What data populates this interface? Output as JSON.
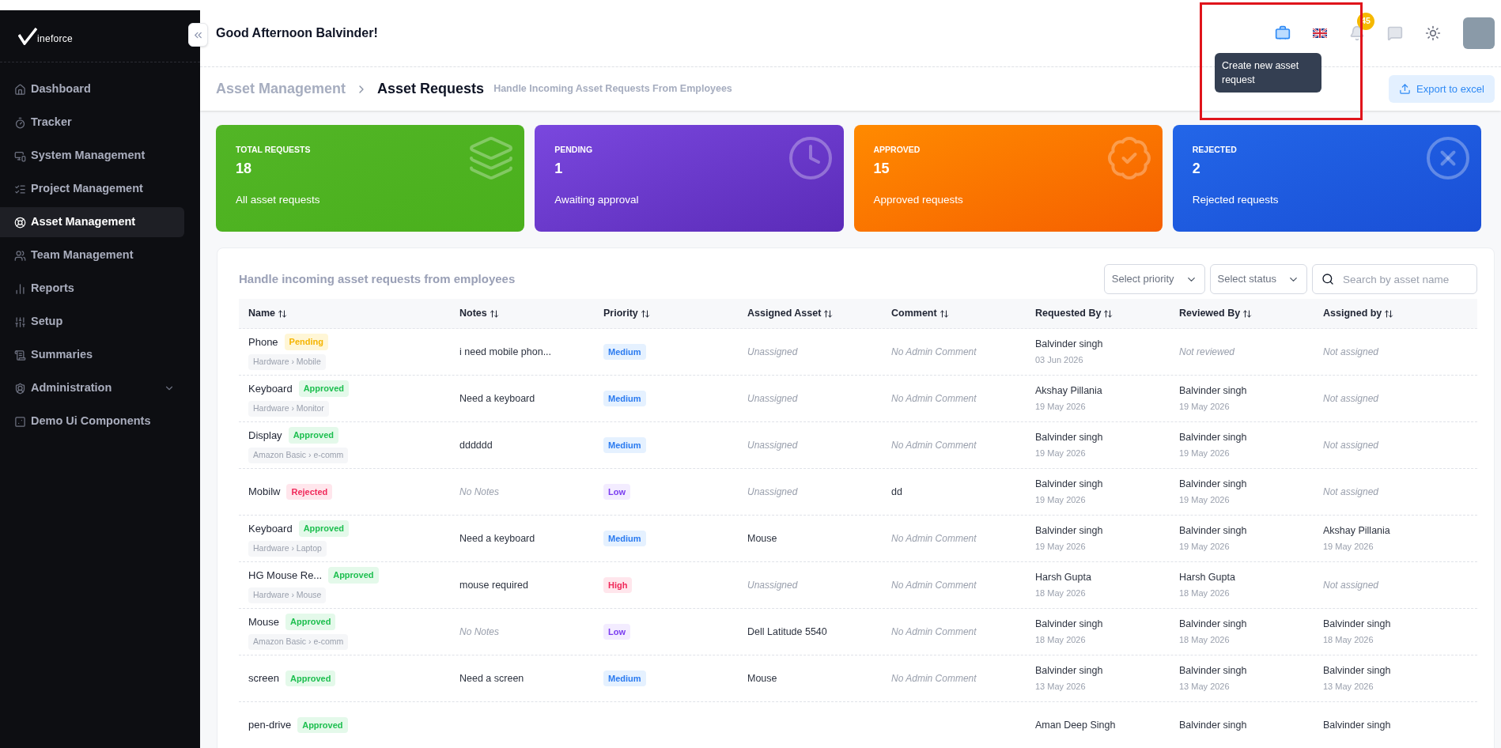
{
  "logo": {
    "text": "ineforce"
  },
  "sidebar": {
    "items": [
      {
        "label": "Dashboard",
        "selected": false
      },
      {
        "label": "Tracker",
        "selected": false
      },
      {
        "label": "System Management",
        "selected": false
      },
      {
        "label": "Project Management",
        "selected": false
      },
      {
        "label": "Asset Management",
        "selected": true
      },
      {
        "label": "Team Management",
        "selected": false
      },
      {
        "label": "Reports",
        "selected": false
      },
      {
        "label": "Setup",
        "selected": false
      },
      {
        "label": "Summaries",
        "selected": false
      },
      {
        "label": "Administration",
        "selected": false,
        "expandable": true
      },
      {
        "label": "Demo Ui Components",
        "selected": false
      }
    ]
  },
  "header": {
    "greeting": "Good Afternoon Balvinder!",
    "notification_count": "45",
    "tooltip": "Create new asset request"
  },
  "breadcrumb": {
    "parent": "Asset Management",
    "current": "Asset Requests",
    "subtitle": "Handle Incoming Asset Requests From Employees",
    "export_button": "Export to excel"
  },
  "stats": [
    {
      "kind": "total",
      "label": "TOTAL REQUESTS",
      "value": "18",
      "caption": "All asset requests"
    },
    {
      "kind": "pending",
      "label": "PENDING",
      "value": "1",
      "caption": "Awaiting approval"
    },
    {
      "kind": "approved",
      "label": "APPROVED",
      "value": "15",
      "caption": "Approved requests"
    },
    {
      "kind": "rejected",
      "label": "REJECTED",
      "value": "2",
      "caption": "Rejected requests"
    }
  ],
  "table": {
    "title": "Handle incoming asset requests from employees",
    "filters": [
      {
        "placeholder": "Select priority"
      },
      {
        "placeholder": "Select status"
      }
    ],
    "search": {
      "placeholder": "Search by asset name"
    },
    "columns": [
      "Name",
      "Notes",
      "Priority",
      "Assigned Asset",
      "Comment",
      "Requested By",
      "Reviewed By",
      "Assigned by"
    ],
    "rows": [
      {
        "name": "Phone",
        "status": {
          "kind": "pending",
          "text": "Pending"
        },
        "category": "Hardware › Mobile",
        "notes": {
          "text": "i need mobile phon...",
          "empty": false
        },
        "priority": {
          "kind": "medium",
          "text": "Medium"
        },
        "asset": {
          "text": "Unassigned",
          "empty": true
        },
        "comment": {
          "text": "No Admin Comment",
          "empty": true
        },
        "requested": {
          "text": "Balvinder singh",
          "date": "03 Jun 2026",
          "empty": false
        },
        "reviewed": {
          "text": "Not reviewed",
          "empty": true
        },
        "assigned_by": {
          "text": "Not assigned",
          "empty": true
        }
      },
      {
        "name": "Keyboard",
        "status": {
          "kind": "approved",
          "text": "Approved"
        },
        "category": "Hardware › Monitor",
        "notes": {
          "text": "Need a keyboard",
          "empty": false
        },
        "priority": {
          "kind": "medium",
          "text": "Medium"
        },
        "asset": {
          "text": "Unassigned",
          "empty": true
        },
        "comment": {
          "text": "No Admin Comment",
          "empty": true
        },
        "requested": {
          "text": "Akshay Pillania",
          "date": "19 May 2026",
          "empty": false
        },
        "reviewed": {
          "text": "Balvinder singh",
          "date": "19 May 2026",
          "empty": false
        },
        "assigned_by": {
          "text": "Not assigned",
          "empty": true
        }
      },
      {
        "name": "Display",
        "status": {
          "kind": "approved",
          "text": "Approved"
        },
        "category": "Amazon Basic › e-comm",
        "notes": {
          "text": "dddddd",
          "empty": false
        },
        "priority": {
          "kind": "medium",
          "text": "Medium"
        },
        "asset": {
          "text": "Unassigned",
          "empty": true
        },
        "comment": {
          "text": "No Admin Comment",
          "empty": true
        },
        "requested": {
          "text": "Balvinder singh",
          "date": "19 May 2026",
          "empty": false
        },
        "reviewed": {
          "text": "Balvinder singh",
          "date": "19 May 2026",
          "empty": false
        },
        "assigned_by": {
          "text": "Not assigned",
          "empty": true
        }
      },
      {
        "name": "Mobilw",
        "status": {
          "kind": "rejected",
          "text": "Rejected"
        },
        "notes": {
          "text": "No Notes",
          "empty": true
        },
        "priority": {
          "kind": "low",
          "text": "Low"
        },
        "asset": {
          "text": "Unassigned",
          "empty": true
        },
        "comment": {
          "text": "dd",
          "empty": false
        },
        "requested": {
          "text": "Balvinder singh",
          "date": "19 May 2026",
          "empty": false
        },
        "reviewed": {
          "text": "Balvinder singh",
          "date": "19 May 2026",
          "empty": false
        },
        "assigned_by": {
          "text": "Not assigned",
          "empty": true
        }
      },
      {
        "name": "Keyboard",
        "status": {
          "kind": "approved",
          "text": "Approved"
        },
        "category": "Hardware › Laptop",
        "notes": {
          "text": "Need a keyboard",
          "empty": false
        },
        "priority": {
          "kind": "medium",
          "text": "Medium"
        },
        "asset": {
          "text": "Mouse",
          "empty": false
        },
        "comment": {
          "text": "No Admin Comment",
          "empty": true
        },
        "requested": {
          "text": "Balvinder singh",
          "date": "19 May 2026",
          "empty": false
        },
        "reviewed": {
          "text": "Balvinder singh",
          "date": "19 May 2026",
          "empty": false
        },
        "assigned_by": {
          "text": "Akshay Pillania",
          "date": "19 May 2026",
          "empty": false
        }
      },
      {
        "name": "HG Mouse Re...",
        "status": {
          "kind": "approved",
          "text": "Approved"
        },
        "category": "Hardware › Mouse",
        "notes": {
          "text": "mouse required",
          "empty": false
        },
        "priority": {
          "kind": "high",
          "text": "High"
        },
        "asset": {
          "text": "Unassigned",
          "empty": true
        },
        "comment": {
          "text": "No Admin Comment",
          "empty": true
        },
        "requested": {
          "text": "Harsh Gupta",
          "date": "18 May 2026",
          "empty": false
        },
        "reviewed": {
          "text": "Harsh Gupta",
          "date": "18 May 2026",
          "empty": false
        },
        "assigned_by": {
          "text": "Not assigned",
          "empty": true
        }
      },
      {
        "name": "Mouse",
        "status": {
          "kind": "approved",
          "text": "Approved"
        },
        "category": "Amazon Basic › e-comm",
        "notes": {
          "text": "No Notes",
          "empty": true
        },
        "priority": {
          "kind": "low",
          "text": "Low"
        },
        "asset": {
          "text": "Dell Latitude 5540",
          "empty": false
        },
        "comment": {
          "text": "No Admin Comment",
          "empty": true
        },
        "requested": {
          "text": "Balvinder singh",
          "date": "18 May 2026",
          "empty": false
        },
        "reviewed": {
          "text": "Balvinder singh",
          "date": "18 May 2026",
          "empty": false
        },
        "assigned_by": {
          "text": "Balvinder singh",
          "date": "18 May 2026",
          "empty": false
        }
      },
      {
        "name": "screen",
        "status": {
          "kind": "approved",
          "text": "Approved"
        },
        "notes": {
          "text": "Need a screen",
          "empty": false
        },
        "priority": {
          "kind": "medium",
          "text": "Medium"
        },
        "asset": {
          "text": "Mouse",
          "empty": false
        },
        "comment": {
          "text": "No Admin Comment",
          "empty": true
        },
        "requested": {
          "text": "Balvinder singh",
          "date": "13 May 2026",
          "empty": false
        },
        "reviewed": {
          "text": "Balvinder singh",
          "date": "13 May 2026",
          "empty": false
        },
        "assigned_by": {
          "text": "Balvinder singh",
          "date": "13 May 2026",
          "empty": false
        }
      },
      {
        "name": "pen-drive",
        "status": {
          "kind": "approved",
          "text": "Approved"
        },
        "requested": {
          "text": "Aman Deep Singh",
          "empty": false
        },
        "reviewed": {
          "text": "Balvinder singh",
          "empty": false
        },
        "assigned_by": {
          "text": "Balvinder singh",
          "empty": false
        }
      }
    ]
  }
}
